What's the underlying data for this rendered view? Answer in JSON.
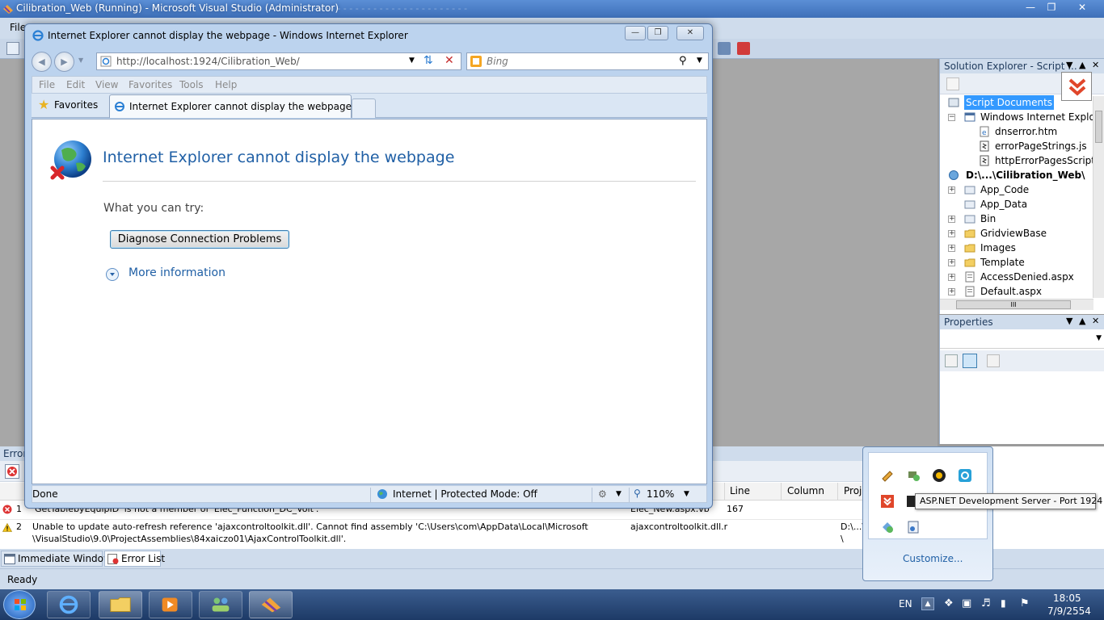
{
  "vs": {
    "title": "Cilibration_Web (Running) - Microsoft Visual Studio (Administrator)",
    "menu_file": "File",
    "status": "Ready",
    "bottom_tabs": [
      "Immediate Window",
      "Error List"
    ],
    "error_panel_title": "Error"
  },
  "solution_explorer": {
    "title": "Solution Explorer - Script ...",
    "items": [
      {
        "label": "Script Documents",
        "selected": true
      },
      {
        "label": "Windows Internet Explore"
      },
      {
        "label": "dnserror.htm"
      },
      {
        "label": "errorPageStrings.js"
      },
      {
        "label": "httpErrorPagesScripts."
      },
      {
        "label": "D:\\...\\Cilibration_Web\\",
        "bold": true
      },
      {
        "label": "App_Code"
      },
      {
        "label": "App_Data"
      },
      {
        "label": "Bin"
      },
      {
        "label": "GridviewBase"
      },
      {
        "label": "Images"
      },
      {
        "label": "Template"
      },
      {
        "label": "AccessDenied.aspx"
      },
      {
        "label": "Default.aspx"
      }
    ],
    "hscroll_grip": "III"
  },
  "properties": {
    "title": "Properties"
  },
  "error_list": {
    "columns": [
      "Line",
      "Column",
      "Proje"
    ],
    "rows": [
      {
        "num": "1",
        "desc": "'GetTablebyEquipID' is not a member of 'Elec_Function_DC_Volt'.",
        "file": "Elec_New.aspx.vb",
        "line": "167",
        "column": "",
        "project": ""
      },
      {
        "num": "2",
        "desc": "Unable to update auto-refresh reference 'ajaxcontroltoolkit.dll'. Cannot find assembly 'C:\\Users\\com\\AppData\\Local\\Microsoft",
        "desc2": "\\VisualStudio\\9.0\\ProjectAssemblies\\84xaiczo01\\AjaxControlToolkit.dll'.",
        "file": "ajaxcontroltoolkit.dll.r",
        "line": "",
        "column": "",
        "project": "D:\\...\\",
        "project2": "\\"
      }
    ]
  },
  "ie": {
    "window_title": "Internet Explorer cannot display the webpage - Windows Internet Explorer",
    "url": "http://localhost:1924/Cilibration_Web/",
    "search_placeholder": "Bing",
    "menu": [
      "File",
      "Edit",
      "View",
      "Favorites",
      "Tools",
      "Help"
    ],
    "favorites_label": "Favorites",
    "tab_title": "Internet Explorer cannot display the webpage",
    "heading": "Internet Explorer cannot display the webpage",
    "try_label": "What you can try:",
    "diagnose_button": "Diagnose Connection Problems",
    "more_info": "More information",
    "status_done": "Done",
    "status_zone": "Internet | Protected Mode: Off",
    "zoom": "110%"
  },
  "tray": {
    "customize": "Customize...",
    "tooltip": "ASP.NET Development Server - Port 1924",
    "language": "EN",
    "time": "18:05",
    "date": "7/9/2554"
  },
  "colors": {
    "ie_link_blue": "#1f5fa5",
    "selection": "#3399ff",
    "taskbar": "#1d3a66"
  }
}
